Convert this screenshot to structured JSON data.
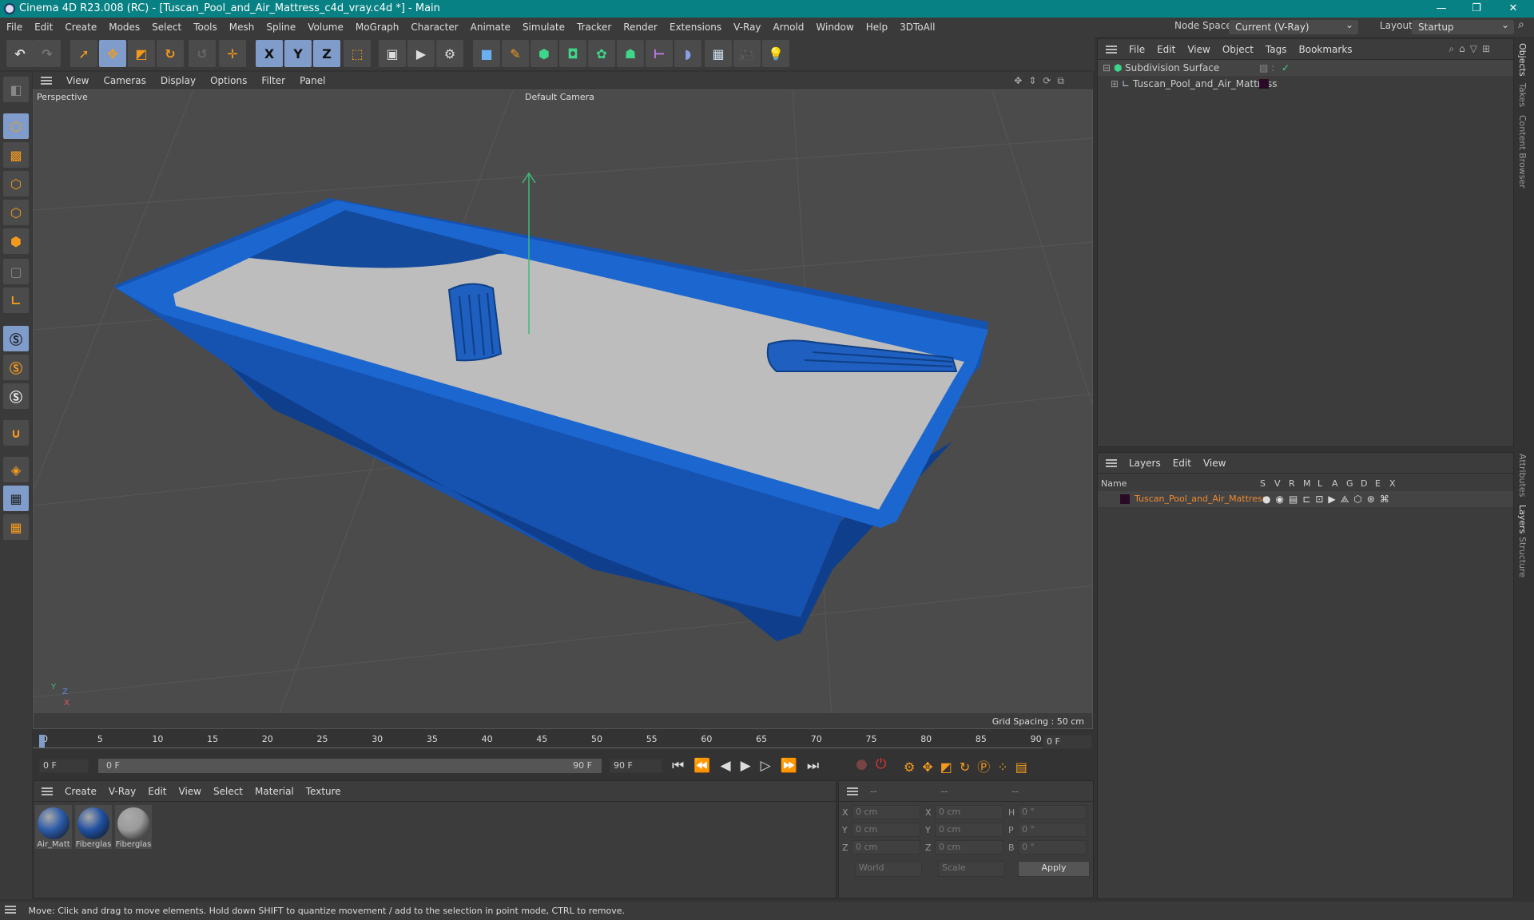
{
  "window": {
    "title": "Cinema 4D R23.008 (RC) - [Tuscan_Pool_and_Air_Mattress_c4d_vray.c4d *] - Main",
    "minimize": "—",
    "maximize": "❐",
    "close": "✕"
  },
  "menubar": [
    "File",
    "Edit",
    "Create",
    "Modes",
    "Select",
    "Tools",
    "Mesh",
    "Spline",
    "Volume",
    "MoGraph",
    "Character",
    "Animate",
    "Simulate",
    "Tracker",
    "Render",
    "Extensions",
    "V-Ray",
    "Arnold",
    "Window",
    "Help",
    "3DToAll"
  ],
  "node_space": {
    "label": "Node Space:",
    "value": "Current (V-Ray)"
  },
  "layout": {
    "label": "Layout:",
    "value": "Startup"
  },
  "toolbar": {
    "x": "X",
    "y": "Y",
    "z": "Z"
  },
  "viewport": {
    "menu": [
      "View",
      "Cameras",
      "Display",
      "Options",
      "Filter",
      "Panel"
    ],
    "view_name": "Perspective",
    "camera": "Default Camera",
    "grid_spacing": "Grid Spacing : 50 cm",
    "axis_y": "Y",
    "axis_z": "Z",
    "axis_x": "X"
  },
  "timeline": {
    "ticks": [
      "0",
      "5",
      "10",
      "15",
      "20",
      "25",
      "30",
      "35",
      "40",
      "45",
      "50",
      "55",
      "60",
      "65",
      "70",
      "75",
      "80",
      "85",
      "90"
    ],
    "current": "0 F",
    "start": "0 F",
    "range_start": "0 F",
    "range_end": "90 F",
    "end": "90 F",
    "progress": 0
  },
  "materials": {
    "menu": [
      "Create",
      "V-Ray",
      "Edit",
      "View",
      "Select",
      "Material",
      "Texture"
    ],
    "items": [
      {
        "name": "Air_Matt",
        "color": "#2a5aa8"
      },
      {
        "name": "Fiberglas",
        "color": "#1f4fa0"
      },
      {
        "name": "Fiberglas",
        "color": "#9a9a9a"
      }
    ]
  },
  "coords": {
    "headers": [
      "--",
      "--",
      "--"
    ],
    "rows": [
      {
        "l1": "X",
        "v1": "0 cm",
        "l2": "X",
        "v2": "0 cm",
        "l3": "H",
        "v3": "0 °"
      },
      {
        "l1": "Y",
        "v1": "0 cm",
        "l2": "Y",
        "v2": "0 cm",
        "l3": "P",
        "v3": "0 °"
      },
      {
        "l1": "Z",
        "v1": "0 cm",
        "l2": "Z",
        "v2": "0 cm",
        "l3": "B",
        "v3": "0 °"
      }
    ],
    "world": "World",
    "scale": "Scale",
    "apply": "Apply"
  },
  "objects": {
    "menu": [
      "File",
      "Edit",
      "View",
      "Object",
      "Tags",
      "Bookmarks"
    ],
    "items": [
      {
        "name": "Subdivision Surface"
      },
      {
        "name": "Tuscan_Pool_and_Air_Mattress",
        "color": "#2a0a24"
      }
    ]
  },
  "layers": {
    "menu": [
      "Layers",
      "Edit",
      "View"
    ],
    "columns": [
      "Name",
      "S",
      "V",
      "R",
      "M",
      "L",
      "A",
      "G",
      "D",
      "E",
      "X"
    ],
    "items": [
      {
        "name": "Tuscan_Pool_and_Air_Mattress",
        "color": "#2a0a24"
      }
    ]
  },
  "right_tabs": [
    "Objects",
    "Takes",
    "Content Browser",
    "Attributes",
    "Layers",
    "Structure"
  ],
  "status": "Move: Click and drag to move elements. Hold down SHIFT to quantize movement / add to the selection in point mode, CTRL to remove.",
  "colors": {
    "titlebar": "#078183",
    "pool": "#1a5fc4",
    "accent": "#f39a1e",
    "selected": "#7f9ccb",
    "layer_name": "#f08a30"
  }
}
